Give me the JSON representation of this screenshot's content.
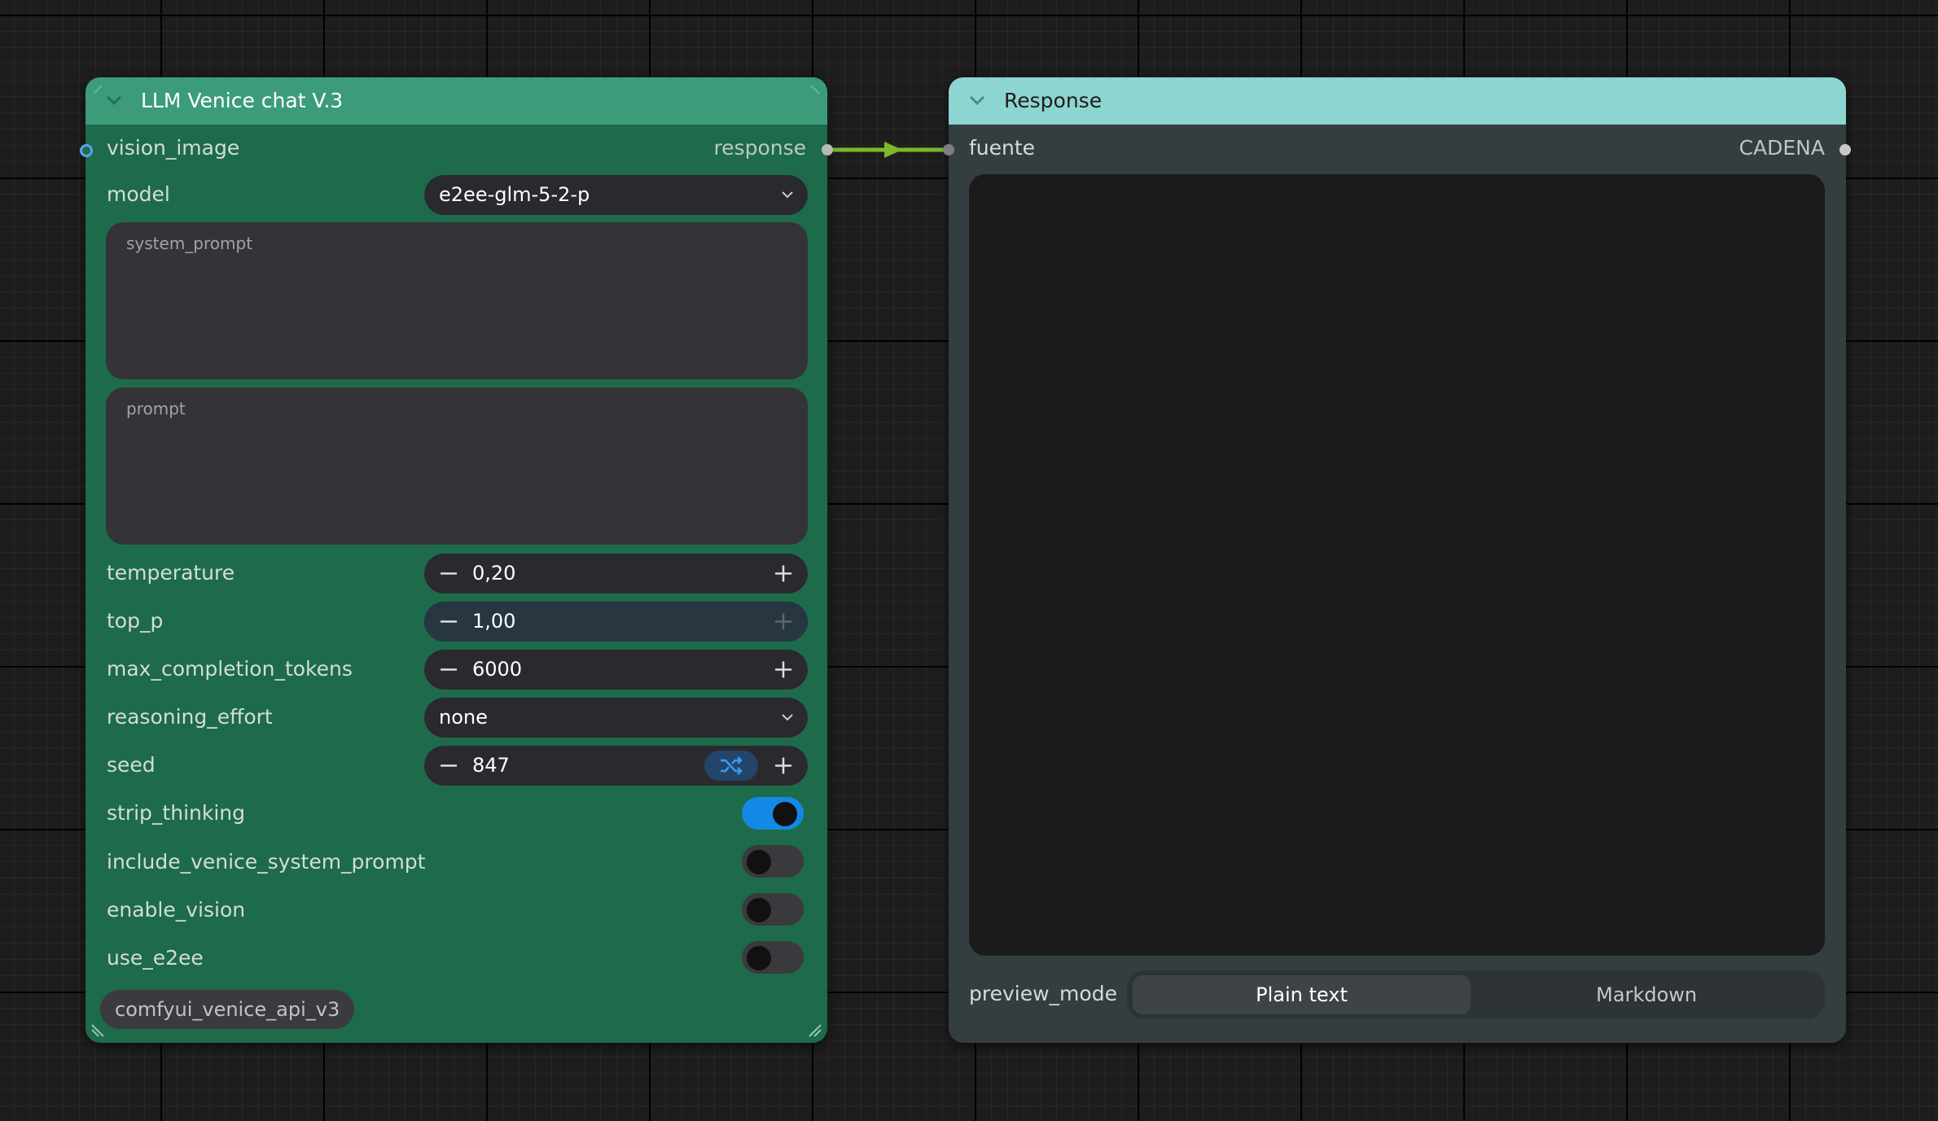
{
  "colors": {
    "llm_node_body": "#1d6b4b",
    "llm_node_header": "#3c9c79",
    "response_node_body": "#343d3f",
    "response_node_header": "#8dd5d0",
    "link": "#7cb82a",
    "toggle_on": "#1488e6"
  },
  "llm_node": {
    "title": "LLM Venice chat V.3",
    "input_slot": "vision_image",
    "output_slot": "response",
    "model": {
      "label": "model",
      "value": "e2ee-glm-5-2-p"
    },
    "system_prompt": {
      "placeholder": "system_prompt"
    },
    "prompt": {
      "placeholder": "prompt"
    },
    "temperature": {
      "label": "temperature",
      "value": "0,20"
    },
    "top_p": {
      "label": "top_p",
      "value": "1,00"
    },
    "max_completion_tokens": {
      "label": "max_completion_tokens",
      "value": "6000"
    },
    "reasoning_effort": {
      "label": "reasoning_effort",
      "value": "none"
    },
    "seed": {
      "label": "seed",
      "value": "847"
    },
    "strip_thinking": {
      "label": "strip_thinking",
      "on": true
    },
    "include_venice_system_prompt": {
      "label": "include_venice_system_prompt",
      "on": false
    },
    "enable_vision": {
      "label": "enable_vision",
      "on": false
    },
    "use_e2ee": {
      "label": "use_e2ee",
      "on": false
    },
    "source_tag": "comfyui_venice_api_v3"
  },
  "response_node": {
    "title": "Response",
    "input_slot": "fuente",
    "output_slot": "CADENA",
    "preview_mode": {
      "label": "preview_mode",
      "options": [
        "Plain text",
        "Markdown"
      ],
      "selected": "Plain text"
    }
  }
}
